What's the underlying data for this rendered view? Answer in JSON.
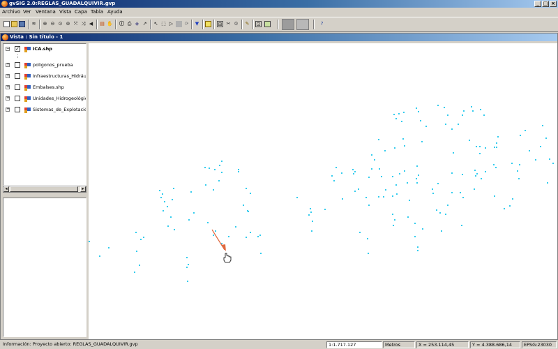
{
  "window": {
    "title": "gvSIG 2.0:REGLAS_GUADALQUIVIR.gvp"
  },
  "menu": [
    "Archivo",
    "Ver",
    "Ventana",
    "Vista",
    "Capa",
    "Tabla",
    "Ayuda"
  ],
  "view": {
    "title": "Vista : Sin título - 1"
  },
  "layers": [
    {
      "name": "ICA.shp",
      "checked": true,
      "expanded": true,
      "selected": true
    },
    {
      "name": "poligonos_prueba",
      "checked": false,
      "expanded": false,
      "selected": false
    },
    {
      "name": "Infraestructuras_Hidráulic",
      "checked": false,
      "expanded": false,
      "selected": false
    },
    {
      "name": "Embalses.shp",
      "checked": false,
      "expanded": false,
      "selected": false
    },
    {
      "name": "Unidades_Hidrogeológicas",
      "checked": false,
      "expanded": false,
      "selected": false
    },
    {
      "name": "Sistemas_de_Explotación.",
      "checked": false,
      "expanded": false,
      "selected": false
    }
  ],
  "status": {
    "message": "Información: Proyecto abierto: REGLAS_GUADALQUIVIR.gvp",
    "scale": "1:1.717.127",
    "units": "Metros",
    "x": "X = 253.114,45",
    "y": "Y = 4.388.686,14",
    "crs": "EPSG:23030"
  },
  "colors": {
    "points": "#33ccee",
    "arrow": "#e06a40",
    "title_dark": "#0a246a",
    "title_light": "#a6caf0"
  },
  "icons": [
    "new-icon",
    "open-icon",
    "save-icon",
    "print-icon",
    "zoom-in-icon",
    "zoom-out-icon",
    "zoom-all-icon",
    "pan-icon",
    "info-icon",
    "select-icon",
    "filter-icon",
    "table-icon",
    "help-icon"
  ]
}
